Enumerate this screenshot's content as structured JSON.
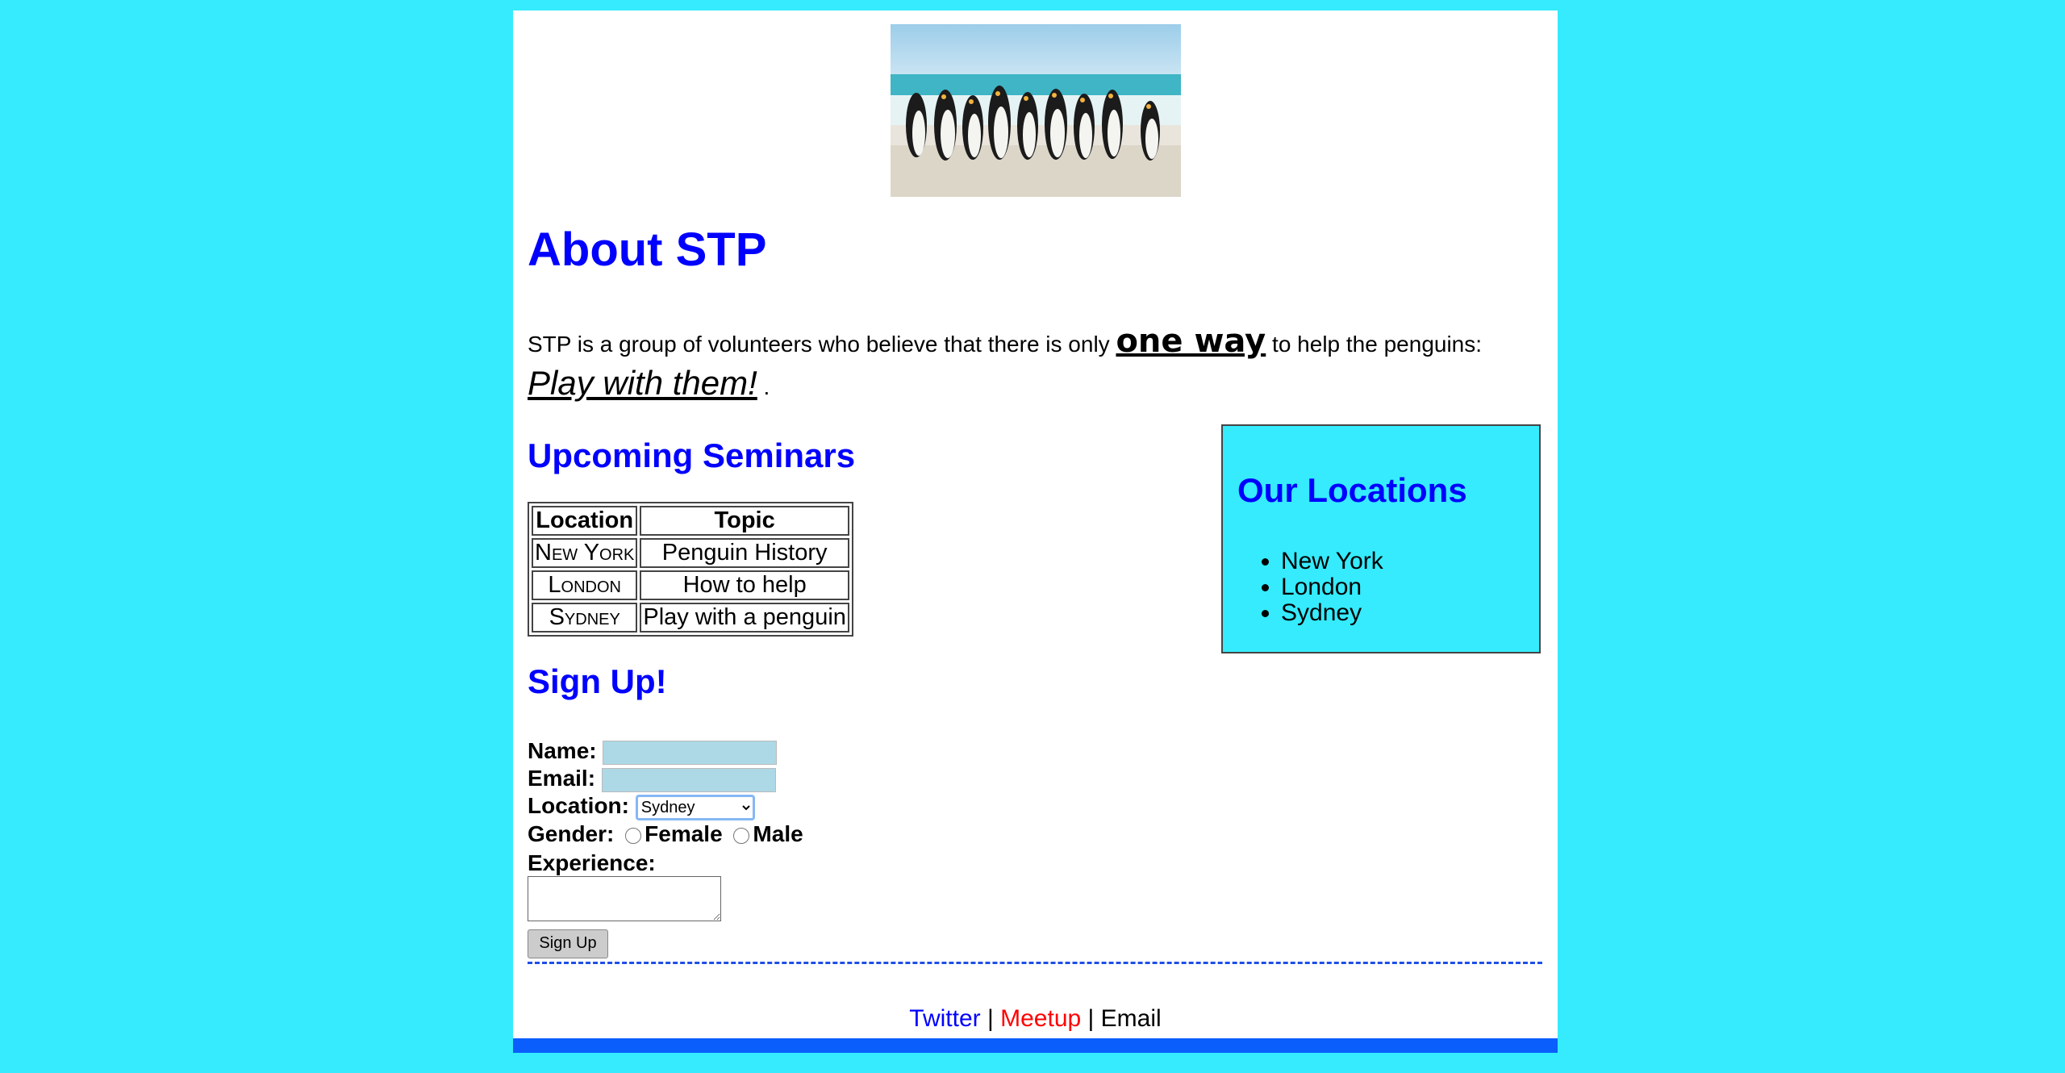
{
  "hero_image": {
    "alt": "penguins-on-beach"
  },
  "about": {
    "title": "About STP",
    "intro_before": "STP is a group of volunteers who believe that there is only",
    "intro_emphasis": "one way",
    "intro_after": "to help the penguins:",
    "intro_play": "Play with them!",
    "intro_end": " ."
  },
  "seminars": {
    "title": "Upcoming Seminars",
    "headers": [
      "Location",
      "Topic"
    ],
    "rows": [
      [
        "New York",
        "Penguin History"
      ],
      [
        "London",
        "How to help"
      ],
      [
        "Sydney",
        "Play with a penguin"
      ]
    ]
  },
  "locations": {
    "title": "Our Locations",
    "items": [
      "New York",
      "London",
      "Sydney"
    ]
  },
  "signup": {
    "title": "Sign Up!",
    "name_label": "Name:",
    "email_label": "Email:",
    "location_label": "Location:",
    "location_selected": "Sydney",
    "gender_label": "Gender:",
    "female_label": "Female",
    "male_label": "Male",
    "experience_label": "Experience:",
    "submit_label": "Sign Up"
  },
  "footer": {
    "twitter": "Twitter",
    "sep1": " | ",
    "meetup": "Meetup",
    "sep2": " | ",
    "email": "Email"
  },
  "colors": {
    "page_background": "#35ebfd",
    "heading": "#0000ff",
    "twitter_link": "#0000ff",
    "meetup_link": "#ff0000",
    "bottom_bar": "#0a5efc"
  }
}
